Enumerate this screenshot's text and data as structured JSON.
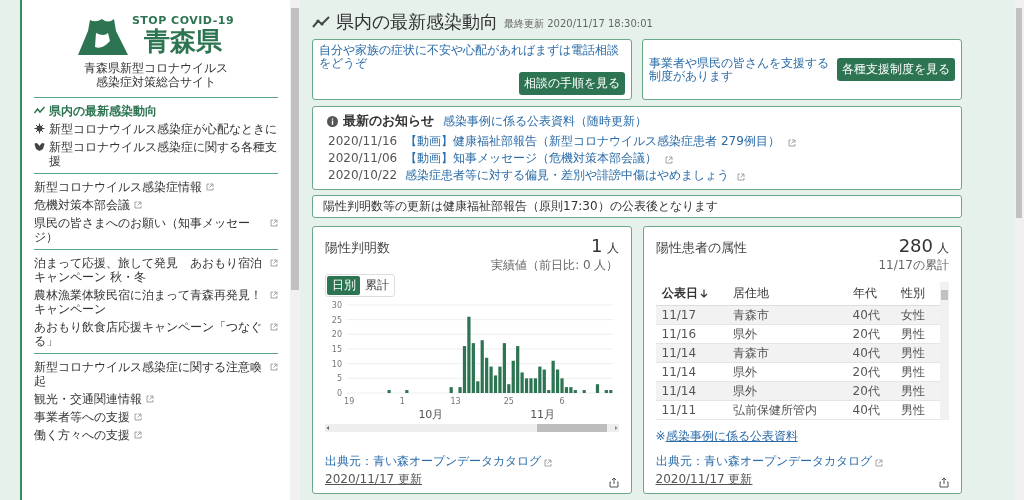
{
  "sidebar": {
    "logo": {
      "tagline": "STOP COVID-19",
      "prefecture": "青森県"
    },
    "site_name": "青森県新型コロナウイルス感染症対策総合サイト",
    "sections": [
      [
        {
          "label": "県内の最新感染動向",
          "selected": true,
          "external": false
        },
        {
          "label": "新型コロナウイルス感染症が心配なときに",
          "selected": false,
          "external": false
        },
        {
          "label": "新型コロナウイルス感染症に関する各種支援",
          "selected": false,
          "external": false
        }
      ],
      [
        {
          "label": "新型コロナウイルス感染症情報",
          "selected": false,
          "external": true
        },
        {
          "label": "危機対策本部会議",
          "selected": false,
          "external": true
        },
        {
          "label": "県民の皆さまへのお願い（知事メッセージ）",
          "selected": false,
          "external": true
        }
      ],
      [
        {
          "label": "泊まって応援、旅して発見　あおもり宿泊キャンペーン 秋・冬",
          "selected": false,
          "external": true
        },
        {
          "label": "農林漁業体験民宿に泊まって青森再発見！キャンペーン",
          "selected": false,
          "external": true
        },
        {
          "label": "あおもり飲食店応援キャンペーン「つなぐる」",
          "selected": false,
          "external": true
        }
      ],
      [
        {
          "label": "新型コロナウイルス感染症に関する注意喚起",
          "selected": false,
          "external": true
        },
        {
          "label": "観光・交通関連情報",
          "selected": false,
          "external": true
        },
        {
          "label": "事業者等への支援",
          "selected": false,
          "external": true
        },
        {
          "label": "働く方々への支援",
          "selected": false,
          "external": true
        }
      ]
    ]
  },
  "main": {
    "title": "県内の最新感染動向",
    "last_updated": "最終更新 2020/11/17 18:30:01",
    "callouts": [
      {
        "text": "自分や家族の症状に不安や心配があればまずは電話相談をどうぞ",
        "button": "相談の手順を見る",
        "kind": "stacked"
      },
      {
        "text": "事業者や県民の皆さんを支援する制度があります",
        "button": "各種支援制度を見る",
        "kind": "inline"
      }
    ],
    "news": {
      "heading": "最新のお知らせ",
      "link": "感染事例に係る公表資料（随時更新）",
      "items": [
        {
          "date": "2020/11/16",
          "text": "【動画】健康福祉部報告（新型コロナウイルス感染症患者 279例目）"
        },
        {
          "date": "2020/11/06",
          "text": "【動画】知事メッセージ（危機対策本部会議）"
        },
        {
          "date": "2020/10/22",
          "text": "感染症患者等に対する偏見・差別や誹謗中傷はやめましょう"
        }
      ]
    },
    "banner": "陽性判明数等の更新は健康福祉部報告（原則17:30）の公表後となります",
    "cards": [
      {
        "kind": "chart",
        "title": "陽性判明数",
        "value": "1",
        "unit": "人",
        "sub": "実績値（前日比: 0 人）",
        "toggles": [
          {
            "label": "日別",
            "selected": true
          },
          {
            "label": "累計",
            "selected": false
          }
        ],
        "chart_data": {
          "type": "bar",
          "categories": [
            "19",
            null,
            null,
            null,
            null,
            null,
            null,
            null,
            null,
            null,
            null,
            null,
            "1",
            null,
            null,
            null,
            null,
            null,
            null,
            null,
            null,
            null,
            null,
            null,
            "13",
            null,
            null,
            null,
            null,
            null,
            null,
            null,
            null,
            null,
            null,
            null,
            "25",
            null,
            null,
            null,
            null,
            null,
            null,
            null,
            null,
            null,
            null,
            null,
            "6",
            null,
            null,
            null,
            null,
            null,
            null,
            null,
            null,
            null,
            null,
            null
          ],
          "series": [
            {
              "color": "#2d7552",
              "values": [
                0,
                0,
                0,
                0,
                0,
                0,
                0,
                0,
                0,
                1,
                0,
                0,
                0,
                1,
                0,
                0,
                0,
                0,
                0,
                0,
                0,
                0,
                0,
                2,
                0,
                2,
                16,
                26,
                17,
                4,
                18,
                12,
                9,
                6,
                9,
                17,
                3,
                11,
                16,
                7,
                5,
                5,
                5,
                9,
                8,
                1,
                11,
                8,
                5,
                2,
                2,
                1,
                0,
                1,
                0,
                0,
                3,
                0,
                1,
                1
              ]
            }
          ],
          "ylim": [
            0,
            30
          ],
          "yticks": [
            0,
            5,
            10,
            15,
            20,
            25,
            30
          ],
          "grid": true,
          "annotations": [
            "10月",
            "11月"
          ]
        },
        "source": "出典元：青い森オープンデータカタログ",
        "updated": "2020/11/17 更新"
      },
      {
        "kind": "table",
        "title": "陽性患者の属性",
        "value": "280",
        "unit": "人",
        "sub": "11/17の累計",
        "table": {
          "columns": [
            {
              "label": "公表日",
              "sorted": true
            },
            {
              "label": "居住地",
              "sorted": false
            },
            {
              "label": "年代",
              "sorted": false
            },
            {
              "label": "性別",
              "sorted": false
            }
          ],
          "rows": [
            [
              "11/17",
              "青森市",
              "40代",
              "女性"
            ],
            [
              "11/16",
              "県外",
              "20代",
              "男性"
            ],
            [
              "11/14",
              "青森市",
              "40代",
              "男性"
            ],
            [
              "11/14",
              "県外",
              "20代",
              "男性"
            ],
            [
              "11/14",
              "県外",
              "20代",
              "男性"
            ],
            [
              "11/11",
              "弘前保健所管内",
              "40代",
              "男性"
            ]
          ]
        },
        "note_prefix": "※",
        "note_link": "感染事例に係る公表資料",
        "source": "出典元：青い森オープンデータカタログ",
        "updated": "2020/11/17 更新"
      }
    ]
  }
}
